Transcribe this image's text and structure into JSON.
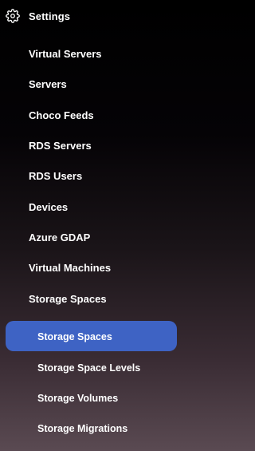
{
  "header": {
    "icon": "gear-icon",
    "label": "Settings"
  },
  "nav": {
    "items": [
      {
        "label": "Virtual Servers"
      },
      {
        "label": "Servers"
      },
      {
        "label": "Choco Feeds"
      },
      {
        "label": "RDS Servers"
      },
      {
        "label": "RDS Users"
      },
      {
        "label": "Devices"
      },
      {
        "label": "Azure GDAP"
      },
      {
        "label": "Virtual Machines"
      },
      {
        "label": "Storage Spaces"
      }
    ],
    "sub_items": [
      {
        "label": "Storage Spaces",
        "active": true
      },
      {
        "label": "Storage Space Levels"
      },
      {
        "label": "Storage Volumes"
      },
      {
        "label": "Storage Migrations"
      }
    ]
  },
  "colors": {
    "active_background": "#3e63c4",
    "text": "#ffffff"
  }
}
